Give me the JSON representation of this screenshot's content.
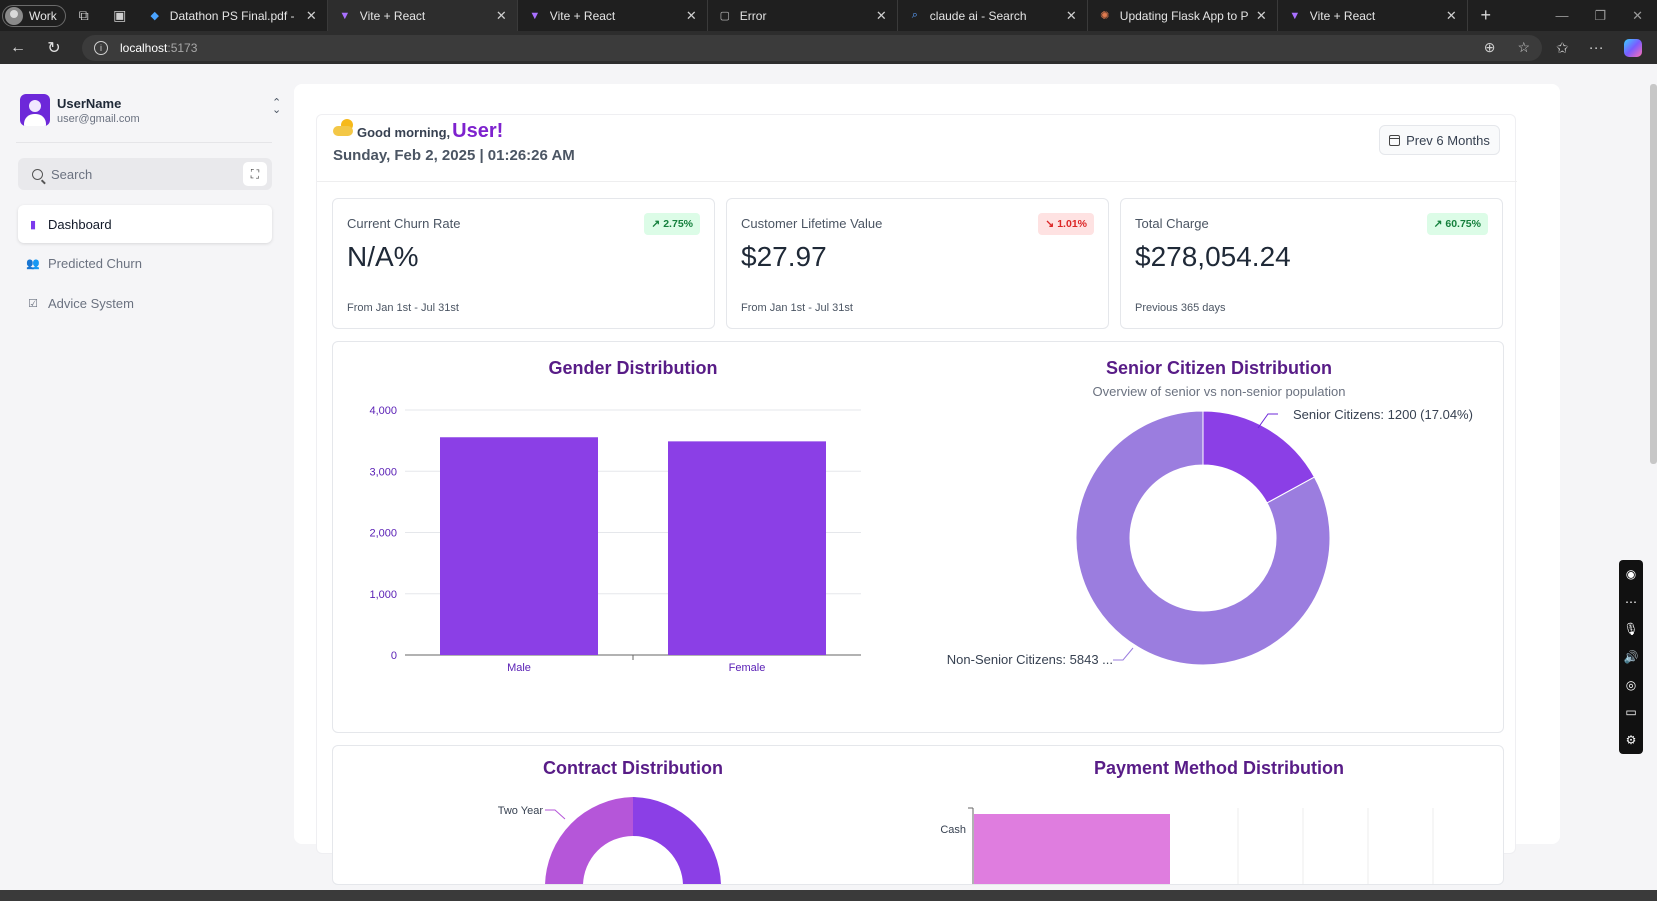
{
  "browser": {
    "profile_label": "Work",
    "tabs": [
      {
        "title": "Datathon PS Final.pdf - Googl",
        "active": false
      },
      {
        "title": "Vite + React",
        "active": true
      },
      {
        "title": "Vite + React",
        "active": false
      },
      {
        "title": "Error",
        "active": false
      },
      {
        "title": "claude ai - Search",
        "active": false
      },
      {
        "title": "Updating Flask App to Proces",
        "active": false
      },
      {
        "title": "Vite + React",
        "active": false
      }
    ],
    "url_host": "localhost",
    "url_port": ":5173"
  },
  "sidebar": {
    "user_name": "UserName",
    "user_email": "user@gmail.com",
    "search_placeholder": "Search",
    "nav": [
      {
        "label": "Dashboard",
        "icon": "bar-chart-icon",
        "active": true
      },
      {
        "label": "Predicted Churn",
        "icon": "users-icon",
        "active": false
      },
      {
        "label": "Advice System",
        "icon": "check-square-icon",
        "active": false
      }
    ]
  },
  "header": {
    "greeting": "Good morning,",
    "name": "User!",
    "datetime": "Sunday, Feb 2, 2025 | 01:26:26 AM",
    "range_button": "Prev 6 Months"
  },
  "metrics": [
    {
      "label": "Current Churn Rate",
      "value": "N/A%",
      "badge": "2.75%",
      "trend": "up",
      "footnote": "From Jan 1st - Jul 31st"
    },
    {
      "label": "Customer Lifetime Value",
      "value": "$27.97",
      "badge": "1.01%",
      "trend": "down",
      "footnote": "From Jan 1st - Jul 31st"
    },
    {
      "label": "Total Charge",
      "value": "$278,054.24",
      "badge": "60.75%",
      "trend": "up",
      "footnote": "Previous 365 days"
    }
  ],
  "colors": {
    "bar": "#8b3fe6",
    "senior": "#8b3fe6",
    "non_senior": "#9b7ddf",
    "contract_two_year": "#b556d9",
    "payment_bar": "#df7ddf",
    "title": "#581c87"
  },
  "chart_data": [
    {
      "type": "bar",
      "title": "Gender Distribution",
      "categories": [
        "Male",
        "Female"
      ],
      "values": [
        3555,
        3488
      ],
      "ylim": [
        0,
        4000
      ],
      "yticks": [
        "4,000",
        "3,000",
        "2,000",
        "1,000",
        "0"
      ],
      "grid": true
    },
    {
      "type": "pie",
      "title": "Senior Citizen Distribution",
      "subtitle": "Overview of senior vs non-senior population",
      "labels": [
        "Senior Citizens: 1200 (17.04%)",
        "Non-Senior Citizens: 5843 ..."
      ],
      "values": [
        1200,
        5843
      ]
    },
    {
      "type": "pie",
      "title": "Contract Distribution",
      "labels": [
        "Two Year"
      ]
    },
    {
      "type": "bar",
      "title": "Payment Method Distribution",
      "categories": [
        "Cash"
      ]
    }
  ]
}
